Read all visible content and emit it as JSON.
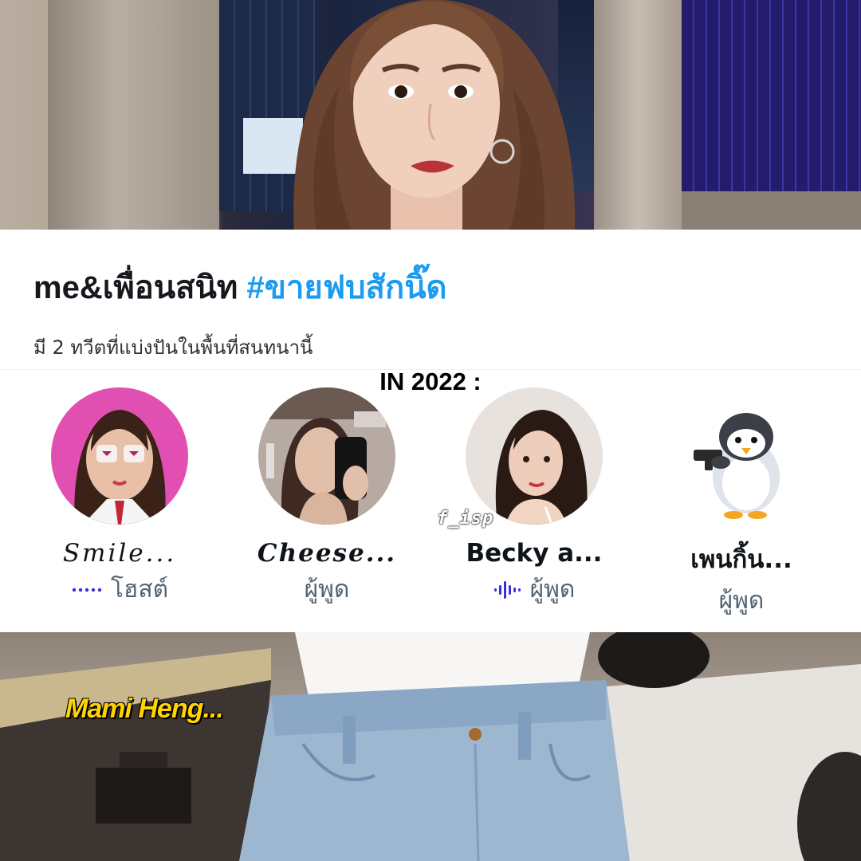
{
  "space": {
    "title_main": "me&เพื่อนสนิท",
    "title_hashtag": "#ขายฟบสักนิ๊ด",
    "subtitle": "มี 2 ทวีตที่แบ่งปันในพื้นที่สนทนานี้"
  },
  "overlay": {
    "year_label": "IN 2022 :",
    "watermark": "f_isp",
    "caption": "Mami Heng..."
  },
  "participants": [
    {
      "name": "Smile...",
      "role": "โฮสต์",
      "indicator": "dots-icon"
    },
    {
      "name": "Cheese...",
      "role": "ผู้พูด",
      "indicator": ""
    },
    {
      "name": "Becky a...",
      "role": "ผู้พูด",
      "indicator": "bars-icon"
    },
    {
      "name": "เพนกิ้น...",
      "role": "ผู้พูด",
      "indicator": ""
    }
  ],
  "colors": {
    "hashtag": "#1d9bf0",
    "indicator": "#3b2fd6",
    "caption": "#ffd400"
  }
}
